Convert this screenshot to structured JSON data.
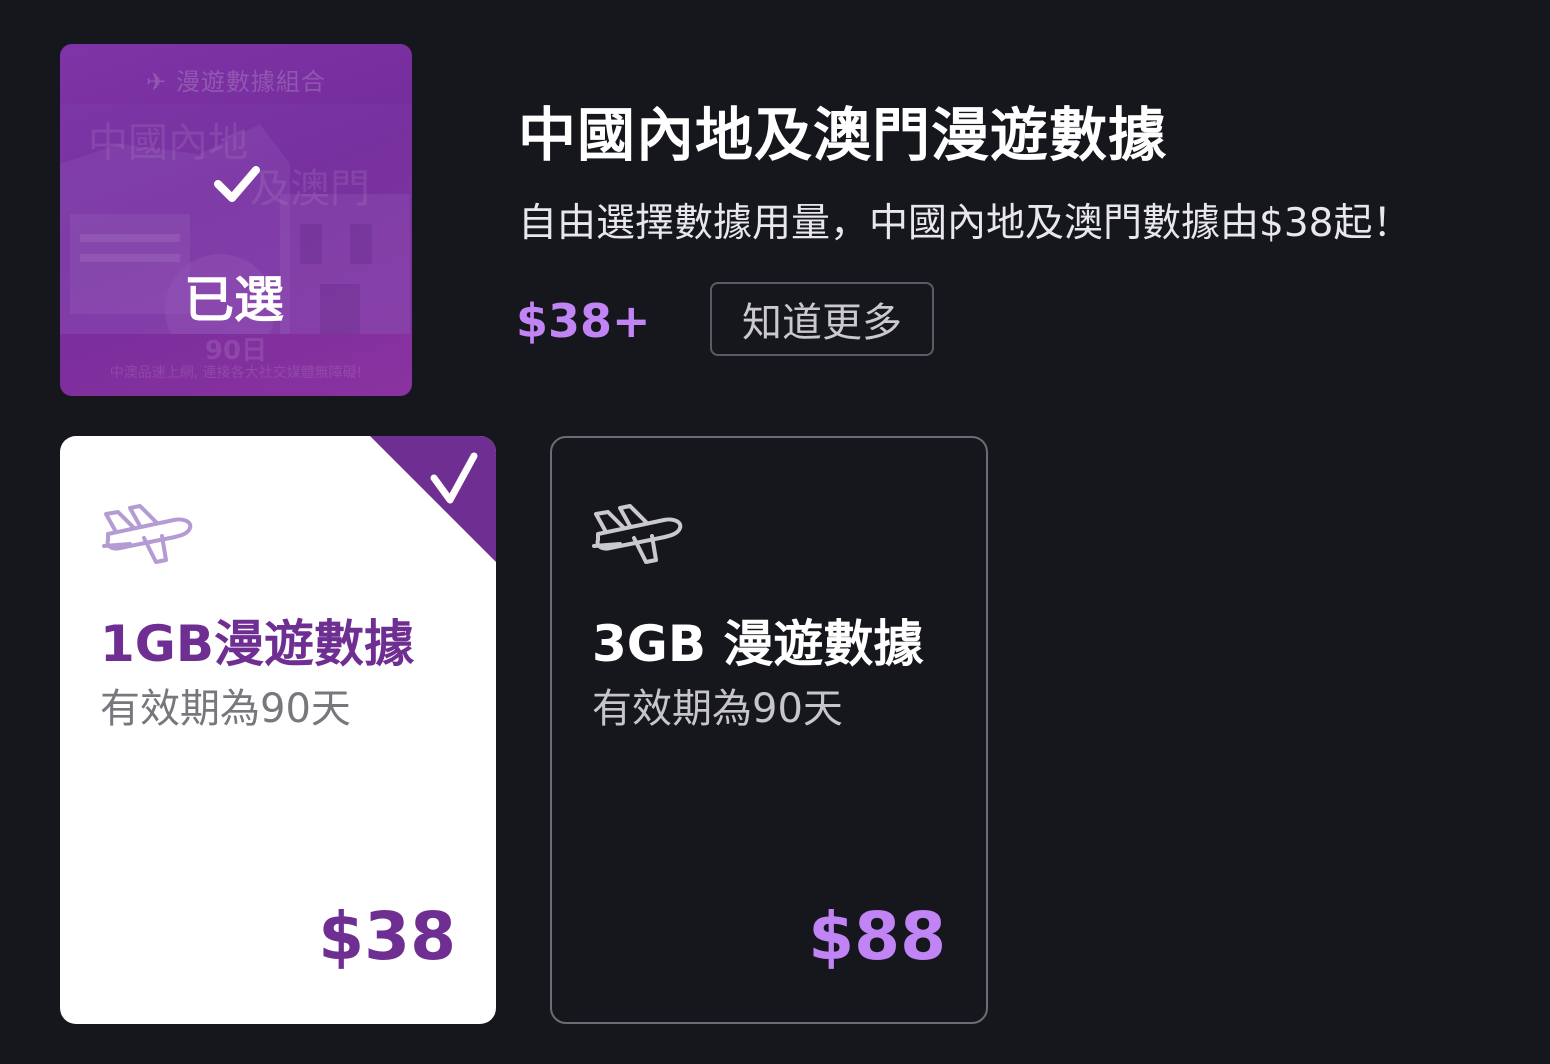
{
  "product": {
    "thumbnail": {
      "tagline": "✈ 漫遊數據組合",
      "line1": "中國內地",
      "line2": "及澳門",
      "bottom_line1": "90日",
      "bottom_line2": "中澳品速上網, 連接各大社交媒體無障礙!",
      "selected_label": "已選"
    },
    "title": "中國內地及澳門漫遊數據",
    "description": "自由選擇數據用量，中國內地及澳門數據由$38起！",
    "price_from": "$38+",
    "learn_more_label": "知道更多"
  },
  "plans": [
    {
      "name": "1GB漫遊數據",
      "validity": "有效期為90天",
      "price": "$38",
      "selected": true
    },
    {
      "name": "3GB 漫遊數據",
      "validity": "有效期為90天",
      "price": "$88",
      "selected": false
    }
  ],
  "icons": {
    "plane": "airplane-icon",
    "check": "checkmark-icon"
  },
  "colors": {
    "background": "#16171c",
    "accent_purple": "#6f2e91",
    "price_lilac": "#c084f5",
    "card_selected_bg": "#ffffff"
  }
}
